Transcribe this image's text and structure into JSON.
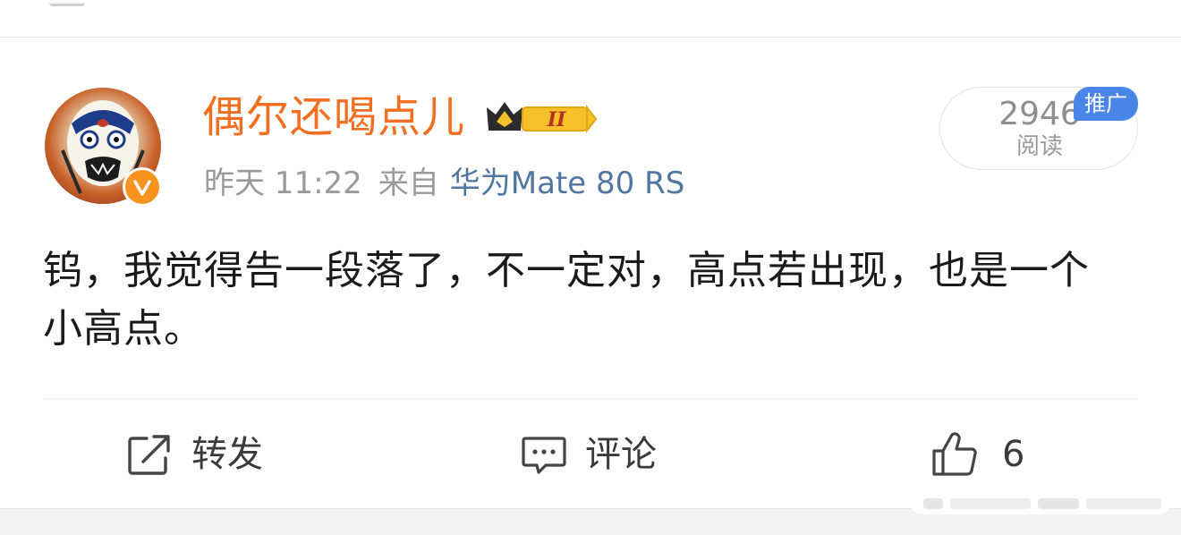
{
  "post": {
    "author": {
      "name": "偶尔还喝点儿",
      "level_badge": "II",
      "verified": true,
      "avatar_icon": "peking-opera-mask-avatar"
    },
    "meta": {
      "time": "昨天 11:22",
      "source_prefix": "来自",
      "source_device": "华为Mate 80 RS"
    },
    "reads": {
      "count": "2946",
      "label": "阅读",
      "promo_tag": "推广"
    },
    "content": "钨，我觉得告一段落了，不一定对，高点若出现，也是一个小高点。"
  },
  "actions": {
    "repost_label": "转发",
    "comment_label": "评论",
    "like_count": "6"
  },
  "colors": {
    "username": "#f26f22",
    "source_link": "#51769f",
    "promo_tag": "#4a86e8",
    "verified_badge": "#f7931e"
  }
}
